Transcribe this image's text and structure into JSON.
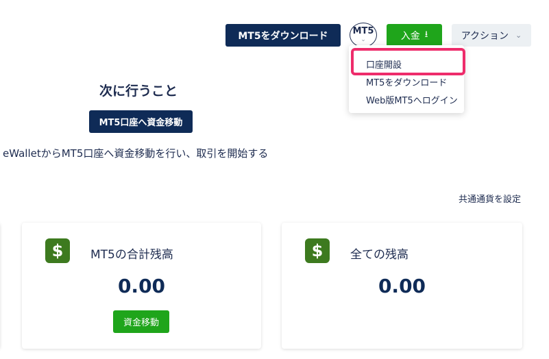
{
  "header": {
    "download_mt5_label": "MT5をダウンロード",
    "mt5_switch_label": "MT5",
    "mt5_switch_chevron": "⌄",
    "deposit_label": "入金",
    "deposit_icon": "⭳",
    "actions_label": "アクション",
    "actions_chevron": "⌄"
  },
  "dropdown": {
    "items": [
      {
        "label": "口座開設"
      },
      {
        "label": "MT5をダウンロード"
      },
      {
        "label": "Web版MT5へログイン"
      }
    ]
  },
  "next_steps": {
    "title": "次に行うこと",
    "button_label": "MT5口座へ資金移動",
    "instruction": "eWalletからMT5口座へ資金移動を行い、取引を開始する"
  },
  "currency_setting_label": "共通通貨を設定",
  "cards": [
    {
      "icon_glyph": "$",
      "title": "MT5の合計残高",
      "amount": "0.00",
      "button_label": "資金移動"
    },
    {
      "icon_glyph": "$",
      "title": "全ての残高",
      "amount": "0.00"
    }
  ],
  "colors": {
    "navy": "#0f2b57",
    "green": "#1fa51b",
    "dollar_icon": "#3d7a1f",
    "highlight": "#ee2c6b"
  }
}
